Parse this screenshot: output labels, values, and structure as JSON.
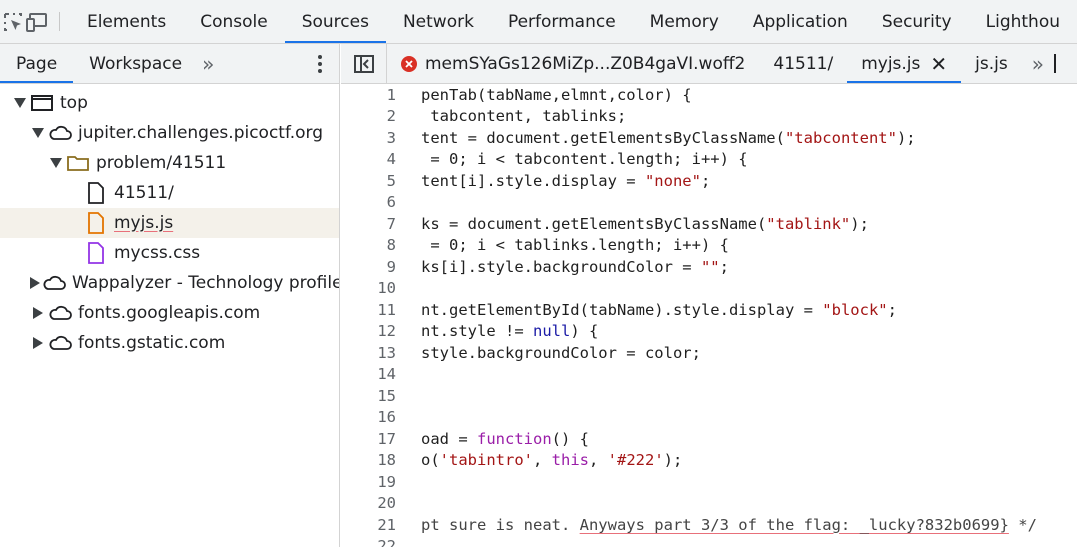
{
  "toolbar": {
    "tabs": [
      "Elements",
      "Console",
      "Sources",
      "Network",
      "Performance",
      "Memory",
      "Application",
      "Security",
      "Lighthou"
    ],
    "active_tab": "Sources"
  },
  "navigator": {
    "tabs": [
      "Page",
      "Workspace"
    ],
    "more_label": "»",
    "tree": [
      {
        "label": "top"
      },
      {
        "label": "jupiter.challenges.picoctf.org"
      },
      {
        "label": "problem/41511"
      },
      {
        "label": "41511/"
      },
      {
        "label": "myjs.js"
      },
      {
        "label": "mycss.css"
      },
      {
        "label": "Wappalyzer - Technology profiler"
      },
      {
        "label": "fonts.googleapis.com"
      },
      {
        "label": "fonts.gstatic.com"
      }
    ]
  },
  "editor": {
    "tabs": [
      "memSYaGs126MiZp...Z0B4gaVI.woff2",
      "41511/",
      "myjs.js",
      "js.js"
    ],
    "active_tab": "myjs.js",
    "more_label": "»",
    "close_label": "✕",
    "lines": [
      {
        "n": "1",
        "text": "penTab(tabName,elmnt,color) {"
      },
      {
        "n": "2",
        "text": " tabcontent, tablinks;"
      },
      {
        "n": "3",
        "pre": "tent = document.getElementsByClassName(",
        "str": "\"tabcontent\"",
        "post": ");"
      },
      {
        "n": "4",
        "text": " = 0; i < tabcontent.length; i++) {"
      },
      {
        "n": "5",
        "pre": "tent[i].style.display = ",
        "str": "\"none\"",
        "post": ";"
      },
      {
        "n": "6",
        "text": ""
      },
      {
        "n": "7",
        "pre": "ks = document.getElementsByClassName(",
        "str": "\"tablink\"",
        "post": ");"
      },
      {
        "n": "8",
        "text": " = 0; i < tablinks.length; i++) {"
      },
      {
        "n": "9",
        "pre": "ks[i].style.backgroundColor = ",
        "str": "\"\"",
        "post": ";"
      },
      {
        "n": "10",
        "text": ""
      },
      {
        "n": "11",
        "pre": "nt.getElementById(tabName).style.display = ",
        "str": "\"block\"",
        "post": ";"
      },
      {
        "n": "12",
        "pre": "nt.style != ",
        "kw2": "null",
        "post": ") {"
      },
      {
        "n": "13",
        "text": "style.backgroundColor = color;"
      },
      {
        "n": "14",
        "text": ""
      },
      {
        "n": "15",
        "text": ""
      },
      {
        "n": "16",
        "text": ""
      },
      {
        "n": "17",
        "pre": "oad = ",
        "kw": "function",
        "post": "() {"
      },
      {
        "n": "18",
        "pre": "o(",
        "str": "'tabintro'",
        "mid": ", ",
        "kw": "this",
        "mid2": ", ",
        "str2": "'#222'",
        "post": ");"
      },
      {
        "n": "19",
        "text": ""
      },
      {
        "n": "20",
        "text": ""
      },
      {
        "n": "21",
        "comment_a": "pt sure is neat. ",
        "comment_b": "Anyways part 3/3 of the flag: _lucky?832b0699}",
        "comment_c": " */"
      },
      {
        "n": "22",
        "text": ""
      }
    ]
  },
  "colors": {
    "accent": "#1a73e8",
    "error": "#d93025",
    "string": "#a31515",
    "keyword": "#9a1ea8"
  }
}
